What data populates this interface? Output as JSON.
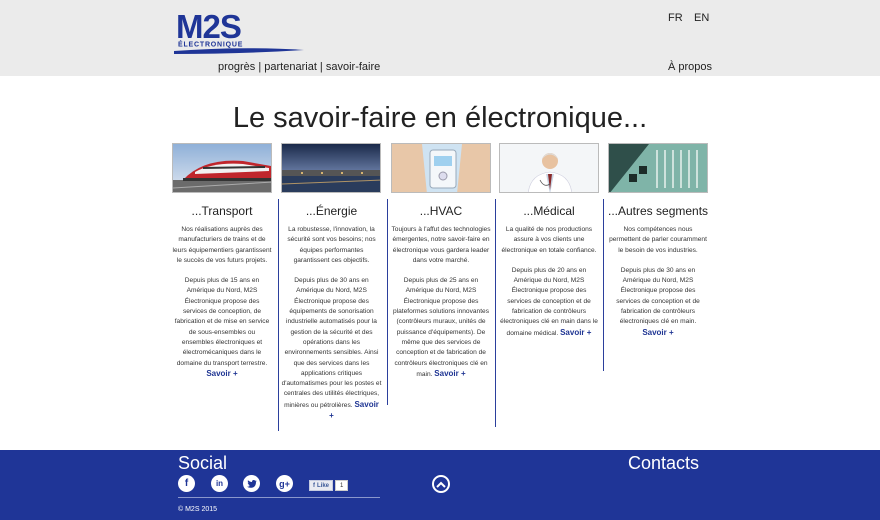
{
  "header": {
    "logo_text": "M2S",
    "logo_subtext": "ÉLECTRONIQUE",
    "lang_fr": "FR",
    "lang_en": "EN",
    "nav": [
      "progrès",
      "partenariat",
      "savoir-faire"
    ],
    "nav_separator": " | ",
    "about": "À propos"
  },
  "main": {
    "title": "Le savoir-faire en électronique..."
  },
  "columns": [
    {
      "title": "...Transport",
      "image": "train-image",
      "paragraphs": [
        "Nos réalisations auprès des manufacturiers de trains et de leurs équipementiers garantissent le succès de vos futurs projets.",
        "Depuis plus de 15 ans en Amérique du Nord, M2S Électronique propose des services de conception,  de fabrication et de mise en service de sous-ensembles ou ensembles électroniques et électromécaniques dans le domaine du transport terrestre."
      ],
      "more": "Savoir +"
    },
    {
      "title": "...Énergie",
      "image": "hydro-dam-image",
      "paragraphs": [
        "La robustesse, l'innovation, la sécurité sont vos besoins; nos équipes performantes garantissent ces objectifs.",
        "Depuis plus de 30 ans en Amérique du Nord, M2S Électronique propose des équipements de sonorisation industrielle automatisés pour la gestion de la sécurité et des opérations dans les environnements sensibles. Ainsi que des services dans les applications critiques d'automatismes pour les postes et centrales des utilités électriques, minières ou pétrolières."
      ],
      "more": "Savoir +"
    },
    {
      "title": "...HVAC",
      "image": "thermostat-image",
      "paragraphs": [
        "Toujours à l'affut des technologies émergentes, notre savoir-faire en électronique vous gardera leader dans votre marché.",
        "Depuis plus de 25 ans en Amérique du Nord, M2S Électronique propose des plateformes solutions innovantes (contrôleurs muraux, unités de puissance d'équipements). De même que des services de conception et  de fabrication de contrôleurs électroniques clé en main."
      ],
      "more": "Savoir +"
    },
    {
      "title": "...Médical",
      "image": "doctor-image",
      "paragraphs": [
        "La qualité de nos productions assure à vos clients une électronique en totale confiance.",
        "Depuis plus de 20 ans en Amérique du Nord, M2S Électronique propose des services de conception et de fabrication de contrôleurs électroniques clé en main dans le domaine médical."
      ],
      "more": "Savoir +"
    },
    {
      "title": "...Autres segments",
      "image": "circuit-board-image",
      "paragraphs": [
        "Nos compétences nous permettent de parler couramment le besoin de vos industries.",
        "Depuis plus de 30 ans en Amérique du Nord, M2S Électronique propose des services de conception et de fabrication de contrôleurs électroniques clé en main."
      ],
      "more": "Savoir +"
    }
  ],
  "footer": {
    "social_title": "Social",
    "contacts_title": "Contacts",
    "social_icons": [
      "facebook-icon",
      "linkedin-icon",
      "twitter-icon",
      "google-plus-icon"
    ],
    "like_label": "Like",
    "like_count": "1",
    "copyright": "© M2S 2015"
  },
  "colors": {
    "brand_blue": "#1f3597",
    "header_bg": "#ebebeb",
    "link_blue": "#1f3593"
  }
}
